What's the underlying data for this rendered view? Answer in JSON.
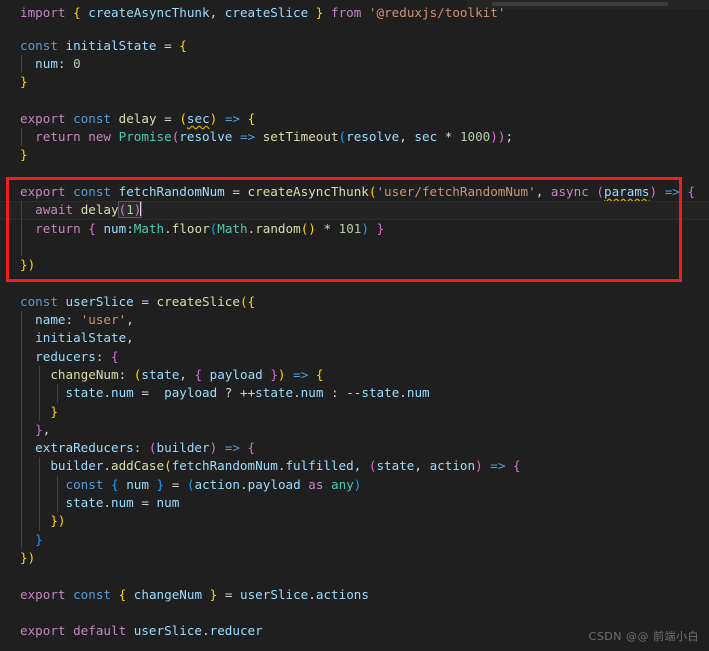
{
  "editor": {
    "language": "typescript",
    "theme": "dark-plus",
    "background_color": "#1f1f1f",
    "current_line_background": "#232323",
    "minimap": {
      "present": true,
      "slider_color": "#3c3c3c"
    },
    "annotation": {
      "type": "red-rectangle",
      "color": "#f01d1d",
      "covers_lines": [
        "export const fetchRandomNum = createAsyncThunk('user/fetchRandomNum', async (params) => {",
        "await delay(1)",
        "return { num:Math.floor(Math.random() * 101) }",
        "})"
      ]
    },
    "caret": {
      "line": "await delay(1)",
      "after_text": "delay(1)"
    }
  },
  "code": {
    "l1": {
      "k1": "import",
      "b1": "{",
      "i1": "createAsyncThunk",
      "c1": ",",
      "i2": "createSlice",
      "b2": "}",
      "k2": "from",
      "s1": "'@reduxjs/toolkit'"
    },
    "l2": {
      "blank": ""
    },
    "l3": {
      "k1": "const",
      "i1": "initialState",
      "op": "=",
      "b1": "{"
    },
    "l4": {
      "p1": "num:",
      "n1": "0"
    },
    "l5": {
      "b1": "}"
    },
    "l6": {
      "blank": ""
    },
    "l7": {
      "k1": "export",
      "k2": "const",
      "i1": "delay",
      "op": "=",
      "b1": "(",
      "i2": "sec",
      "b2": ")",
      "arrow": "=>",
      "b3": "{"
    },
    "l8": {
      "k1": "return",
      "k2": "new",
      "t1": "Promise",
      "b1": "(",
      "i1": "resolve",
      "arrow": "=>",
      "f1": "setTimeout",
      "b2": "(",
      "i2": "resolve",
      "c1": ",",
      "i3": "sec",
      "op": "*",
      "n1": "1000",
      "b3": "))",
      "semi": ";"
    },
    "l9": {
      "b1": "}"
    },
    "l10": {
      "blank": ""
    },
    "l11": {
      "k1": "export",
      "k2": "const",
      "i1": "fetchRandomNum",
      "op": "=",
      "f1": "createAsyncThunk",
      "b1": "(",
      "s1": "'user/fetchRandomNum'",
      "c1": ",",
      "k3": "async",
      "b2": "(",
      "i2": "params",
      "b3": ")",
      "arrow": "=>",
      "b4": "{"
    },
    "l12": {
      "k1": "await",
      "f1": "delay",
      "b1": "(",
      "n1": "1",
      "b2": ")"
    },
    "l13": {
      "k1": "return",
      "b1": "{",
      "p1": "num:",
      "t1": "Math",
      "d1": ".",
      "f1": "floor",
      "b2": "(",
      "t2": "Math",
      "d2": ".",
      "f2": "random",
      "b3": "()",
      "op": "*",
      "n1": "101",
      "b4": ")",
      "b5": "}"
    },
    "l14": {
      "blank": ""
    },
    "l15": {
      "b1": "})"
    },
    "l16": {
      "blank": ""
    },
    "l17": {
      "k1": "const",
      "i1": "userSlice",
      "op": "=",
      "f1": "createSlice",
      "b1": "({"
    },
    "l18": {
      "p1": "name:",
      "s1": "'user'",
      "c1": ","
    },
    "l19": {
      "i1": "initialState",
      "c1": ","
    },
    "l20": {
      "p1": "reducers:",
      "b1": "{"
    },
    "l21": {
      "f1": "changeNum:",
      "b1": "(",
      "i1": "state",
      "c1": ",",
      "b2": "{",
      "i2": "payload",
      "b3": "}",
      "b4": ")",
      "arrow": "=>",
      "b5": "{"
    },
    "l22": {
      "i1": "state",
      "d1": ".",
      "p1": "num",
      "op": "=",
      "i2": "payload",
      "q": "?",
      "inc": "++",
      "i3": "state",
      "d2": ".",
      "p2": "num",
      "colon": ":",
      "dec": "--",
      "i4": "state",
      "d3": ".",
      "p3": "num"
    },
    "l23": {
      "b1": "}"
    },
    "l24": {
      "b1": "}",
      "c1": ","
    },
    "l25": {
      "p1": "extraReducers:",
      "b1": "(",
      "i1": "builder",
      "b2": ")",
      "arrow": "=>",
      "b3": "{"
    },
    "l26": {
      "i1": "builder",
      "d1": ".",
      "f1": "addCase",
      "b1": "(",
      "i2": "fetchRandomNum",
      "d2": ".",
      "p1": "fulfilled",
      "c1": ",",
      "b2": "(",
      "i3": "state",
      "c2": ",",
      "i4": "action",
      "b3": ")",
      "arrow": "=>",
      "b4": "{"
    },
    "l27": {
      "k1": "const",
      "b1": "{",
      "i1": "num",
      "b2": "}",
      "op": "=",
      "b3": "(",
      "i2": "action",
      "d1": ".",
      "p1": "payload",
      "k2": "as",
      "t1": "any",
      "b4": ")"
    },
    "l28": {
      "i1": "state",
      "d1": ".",
      "p1": "num",
      "op": "=",
      "i2": "num"
    },
    "l29": {
      "b1": "})"
    },
    "l30": {
      "b1": "}"
    },
    "l31": {
      "b1": "})"
    },
    "l32": {
      "blank": ""
    },
    "l33": {
      "k1": "export",
      "k2": "const",
      "b1": "{",
      "i1": "changeNum",
      "b2": "}",
      "op": "=",
      "i2": "userSlice",
      "d1": ".",
      "p1": "actions"
    },
    "l34": {
      "blank": ""
    },
    "l35": {
      "k1": "export",
      "k2": "default",
      "i1": "userSlice",
      "d1": ".",
      "p1": "reducer"
    }
  },
  "watermark": {
    "text": "CSDN @@ 前端小白"
  }
}
